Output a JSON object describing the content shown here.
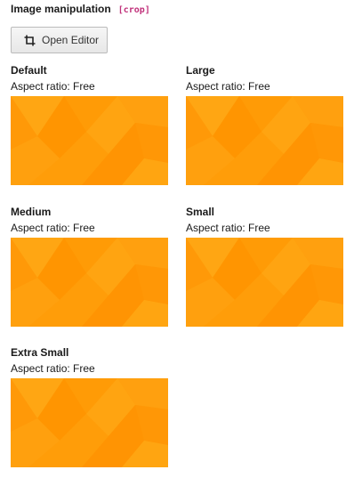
{
  "section": {
    "title": "Image manipulation",
    "tag": "[crop]"
  },
  "editor_button": {
    "label": "Open Editor",
    "icon": "crop-icon"
  },
  "variants": [
    {
      "name": "Default",
      "aspect_ratio": "Aspect ratio: Free"
    },
    {
      "name": "Large",
      "aspect_ratio": "Aspect ratio: Free"
    },
    {
      "name": "Medium",
      "aspect_ratio": "Aspect ratio: Free"
    },
    {
      "name": "Small",
      "aspect_ratio": "Aspect ratio: Free"
    },
    {
      "name": "Extra Small",
      "aspect_ratio": "Aspect ratio: Free"
    }
  ],
  "colors": {
    "thumbnail_base": "#ff9e0a",
    "tag": "#c0307a"
  }
}
